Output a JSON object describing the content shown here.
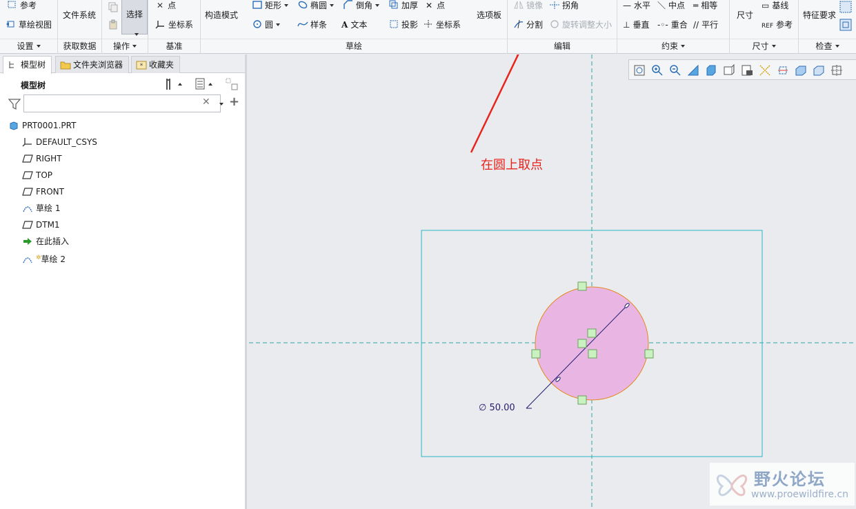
{
  "ribbon": {
    "settings": {
      "ref_label": "参考",
      "sketch_view_label": "草绘视图",
      "group_label": "设置"
    },
    "get_data": {
      "file_system_label": "文件系统",
      "group_label": "获取数据"
    },
    "operations": {
      "select_label": "选择",
      "group_label": "操作"
    },
    "datum": {
      "point_label": "点",
      "csys_label": "坐标系",
      "group_label": "基准"
    },
    "construct_mode_label": "构造模式",
    "sketch": {
      "rectangle_label": "矩形",
      "ellipse_label": "椭圆",
      "chamfer_label": "倒角",
      "thicken_label": "加厚",
      "point_label": "点",
      "circle_label": "圆",
      "spline_label": "样条",
      "text_label": "文本",
      "project_label": "投影",
      "csys_label": "坐标系",
      "palette_label": "选项板",
      "group_label": "草绘"
    },
    "edit": {
      "mirror_label": "镜像",
      "corner_label": "拐角",
      "divide_label": "分割",
      "rotate_resize_label": "旋转调整大小",
      "group_label": "编辑"
    },
    "constrain": {
      "horizontal_label": "水平",
      "midpoint_label": "中点",
      "equal_label": "相等",
      "vertical_label": "垂直",
      "coincident_label": "重合",
      "parallel_label": "平行",
      "group_label": "约束"
    },
    "dimension": {
      "dimension_label": "尺寸",
      "baseline_label": "基线",
      "reference_label": "参考",
      "group_label": "尺寸"
    },
    "inspect": {
      "feature_req_label": "特征要求",
      "group_label": "检查"
    }
  },
  "left_panel": {
    "tabs": [
      {
        "label": "模型树"
      },
      {
        "label": "文件夹浏览器"
      },
      {
        "label": "收藏夹"
      }
    ],
    "tree_title": "模型树",
    "search": {
      "value": "",
      "placeholder": ""
    },
    "tree_items": [
      {
        "label": "PRT0001.PRT",
        "icon": "part-icon"
      },
      {
        "label": "DEFAULT_CSYS",
        "icon": "csys-icon"
      },
      {
        "label": "RIGHT",
        "icon": "datum-plane-icon"
      },
      {
        "label": "TOP",
        "icon": "datum-plane-icon"
      },
      {
        "label": "FRONT",
        "icon": "datum-plane-icon"
      },
      {
        "label": "草绘 1",
        "icon": "sketch-icon"
      },
      {
        "label": "DTM1",
        "icon": "datum-plane-icon"
      },
      {
        "label": "在此插入",
        "icon": "insert-arrow-icon"
      },
      {
        "label": "草绘 2",
        "icon": "sketch-icon"
      }
    ]
  },
  "canvas": {
    "annotation": "在圆上取点",
    "dimension_text": "∅ 50.00",
    "watermark_title": "野火论坛",
    "watermark_url": "www.proewildfire.cn"
  },
  "colors": {
    "accent_blue": "#2a8fc9",
    "circle_fill": "#e9b6e4",
    "circle_stroke": "#e58a1f",
    "centerline": "#2aa5a5",
    "annotation_red": "#e8241c"
  }
}
